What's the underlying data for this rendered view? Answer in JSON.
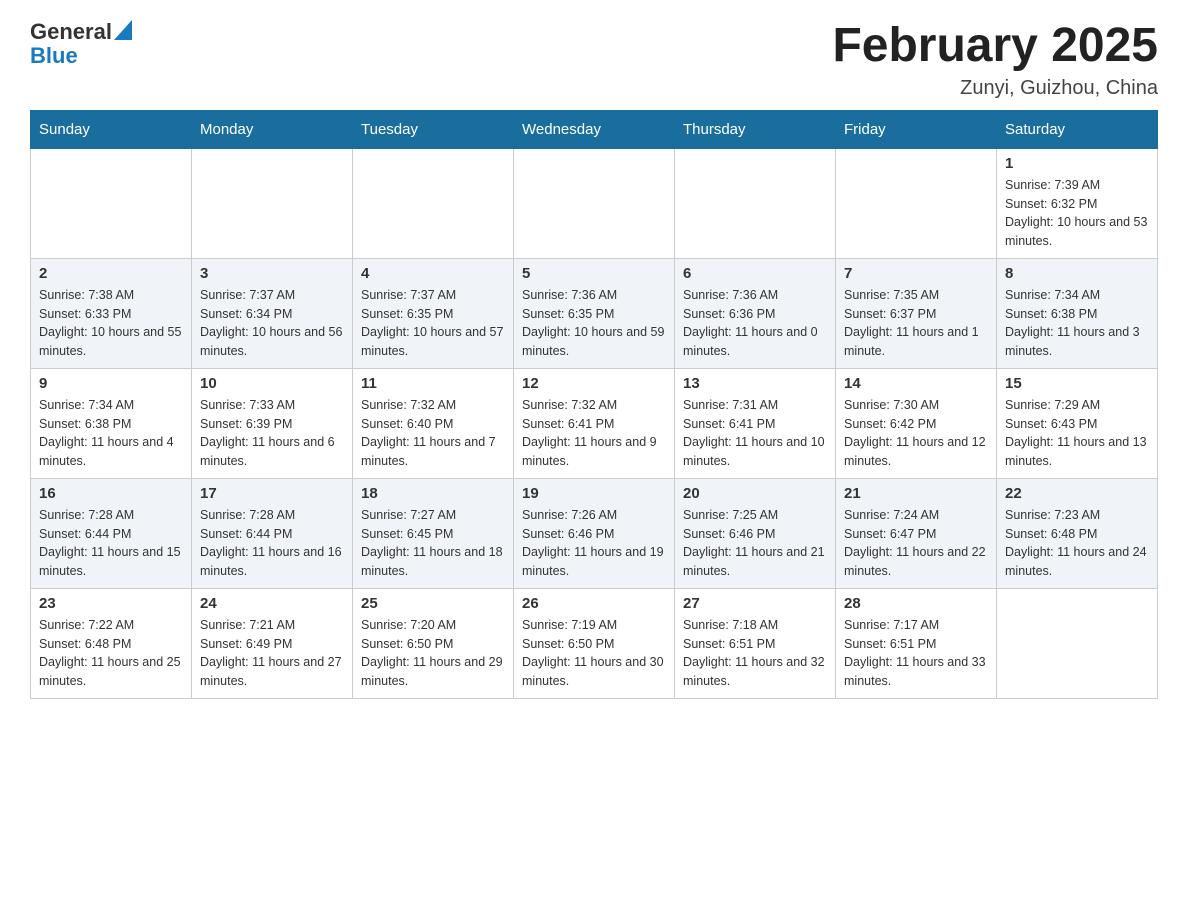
{
  "header": {
    "logo_general": "General",
    "logo_blue": "Blue",
    "month_title": "February 2025",
    "location": "Zunyi, Guizhou, China"
  },
  "days_of_week": [
    "Sunday",
    "Monday",
    "Tuesday",
    "Wednesday",
    "Thursday",
    "Friday",
    "Saturday"
  ],
  "weeks": [
    [
      {
        "day": "",
        "info": ""
      },
      {
        "day": "",
        "info": ""
      },
      {
        "day": "",
        "info": ""
      },
      {
        "day": "",
        "info": ""
      },
      {
        "day": "",
        "info": ""
      },
      {
        "day": "",
        "info": ""
      },
      {
        "day": "1",
        "info": "Sunrise: 7:39 AM\nSunset: 6:32 PM\nDaylight: 10 hours and 53 minutes."
      }
    ],
    [
      {
        "day": "2",
        "info": "Sunrise: 7:38 AM\nSunset: 6:33 PM\nDaylight: 10 hours and 55 minutes."
      },
      {
        "day": "3",
        "info": "Sunrise: 7:37 AM\nSunset: 6:34 PM\nDaylight: 10 hours and 56 minutes."
      },
      {
        "day": "4",
        "info": "Sunrise: 7:37 AM\nSunset: 6:35 PM\nDaylight: 10 hours and 57 minutes."
      },
      {
        "day": "5",
        "info": "Sunrise: 7:36 AM\nSunset: 6:35 PM\nDaylight: 10 hours and 59 minutes."
      },
      {
        "day": "6",
        "info": "Sunrise: 7:36 AM\nSunset: 6:36 PM\nDaylight: 11 hours and 0 minutes."
      },
      {
        "day": "7",
        "info": "Sunrise: 7:35 AM\nSunset: 6:37 PM\nDaylight: 11 hours and 1 minute."
      },
      {
        "day": "8",
        "info": "Sunrise: 7:34 AM\nSunset: 6:38 PM\nDaylight: 11 hours and 3 minutes."
      }
    ],
    [
      {
        "day": "9",
        "info": "Sunrise: 7:34 AM\nSunset: 6:38 PM\nDaylight: 11 hours and 4 minutes."
      },
      {
        "day": "10",
        "info": "Sunrise: 7:33 AM\nSunset: 6:39 PM\nDaylight: 11 hours and 6 minutes."
      },
      {
        "day": "11",
        "info": "Sunrise: 7:32 AM\nSunset: 6:40 PM\nDaylight: 11 hours and 7 minutes."
      },
      {
        "day": "12",
        "info": "Sunrise: 7:32 AM\nSunset: 6:41 PM\nDaylight: 11 hours and 9 minutes."
      },
      {
        "day": "13",
        "info": "Sunrise: 7:31 AM\nSunset: 6:41 PM\nDaylight: 11 hours and 10 minutes."
      },
      {
        "day": "14",
        "info": "Sunrise: 7:30 AM\nSunset: 6:42 PM\nDaylight: 11 hours and 12 minutes."
      },
      {
        "day": "15",
        "info": "Sunrise: 7:29 AM\nSunset: 6:43 PM\nDaylight: 11 hours and 13 minutes."
      }
    ],
    [
      {
        "day": "16",
        "info": "Sunrise: 7:28 AM\nSunset: 6:44 PM\nDaylight: 11 hours and 15 minutes."
      },
      {
        "day": "17",
        "info": "Sunrise: 7:28 AM\nSunset: 6:44 PM\nDaylight: 11 hours and 16 minutes."
      },
      {
        "day": "18",
        "info": "Sunrise: 7:27 AM\nSunset: 6:45 PM\nDaylight: 11 hours and 18 minutes."
      },
      {
        "day": "19",
        "info": "Sunrise: 7:26 AM\nSunset: 6:46 PM\nDaylight: 11 hours and 19 minutes."
      },
      {
        "day": "20",
        "info": "Sunrise: 7:25 AM\nSunset: 6:46 PM\nDaylight: 11 hours and 21 minutes."
      },
      {
        "day": "21",
        "info": "Sunrise: 7:24 AM\nSunset: 6:47 PM\nDaylight: 11 hours and 22 minutes."
      },
      {
        "day": "22",
        "info": "Sunrise: 7:23 AM\nSunset: 6:48 PM\nDaylight: 11 hours and 24 minutes."
      }
    ],
    [
      {
        "day": "23",
        "info": "Sunrise: 7:22 AM\nSunset: 6:48 PM\nDaylight: 11 hours and 25 minutes."
      },
      {
        "day": "24",
        "info": "Sunrise: 7:21 AM\nSunset: 6:49 PM\nDaylight: 11 hours and 27 minutes."
      },
      {
        "day": "25",
        "info": "Sunrise: 7:20 AM\nSunset: 6:50 PM\nDaylight: 11 hours and 29 minutes."
      },
      {
        "day": "26",
        "info": "Sunrise: 7:19 AM\nSunset: 6:50 PM\nDaylight: 11 hours and 30 minutes."
      },
      {
        "day": "27",
        "info": "Sunrise: 7:18 AM\nSunset: 6:51 PM\nDaylight: 11 hours and 32 minutes."
      },
      {
        "day": "28",
        "info": "Sunrise: 7:17 AM\nSunset: 6:51 PM\nDaylight: 11 hours and 33 minutes."
      },
      {
        "day": "",
        "info": ""
      }
    ]
  ]
}
